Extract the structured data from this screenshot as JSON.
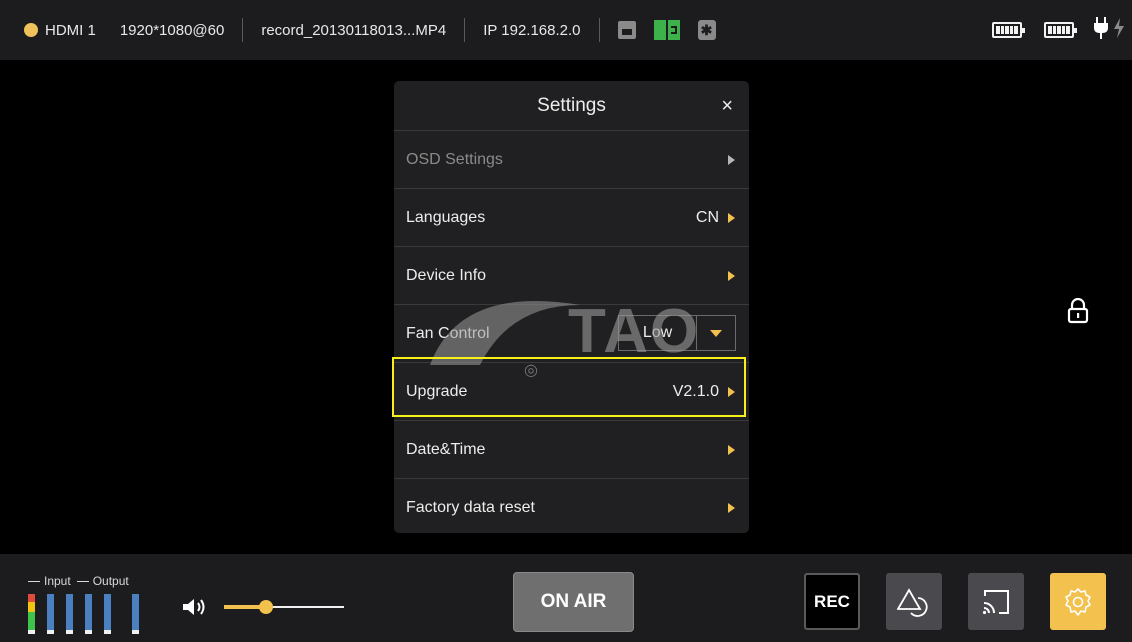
{
  "topbar": {
    "input": "HDMI 1",
    "resolution": "1920*1080@60",
    "filename": "record_20130118013...MP4",
    "ip": "IP 192.168.2.0",
    "icons": [
      "sd-card-icon",
      "storage-card-icon",
      "bluetooth-icon",
      "battery-icon",
      "battery-icon",
      "power-plug-icon",
      "charging-bolt-icon"
    ]
  },
  "settings": {
    "title": "Settings",
    "close": "×",
    "items": [
      {
        "label": "OSD Settings",
        "value": ""
      },
      {
        "label": "Languages",
        "value": "CN"
      },
      {
        "label": "Device Info",
        "value": ""
      },
      {
        "label": "Fan Control",
        "value": "Low"
      },
      {
        "label": "Upgrade",
        "value": "V2.1.0"
      },
      {
        "label": "Date&Time",
        "value": ""
      },
      {
        "label": "Factory data reset",
        "value": ""
      }
    ]
  },
  "watermark": {
    "text": "TAO"
  },
  "bottombar": {
    "legend_input": "Input",
    "legend_output": "Output",
    "volume_level": 0.35,
    "on_air": "ON AIR",
    "rec": "REC"
  },
  "colors": {
    "accent": "#f2c14e",
    "highlight": "#f7ef18",
    "bar_bg": "#1c1c1e",
    "panel_bg": "#202022",
    "status_dot": "#f0c15a",
    "storage_green": "#3db24b"
  }
}
